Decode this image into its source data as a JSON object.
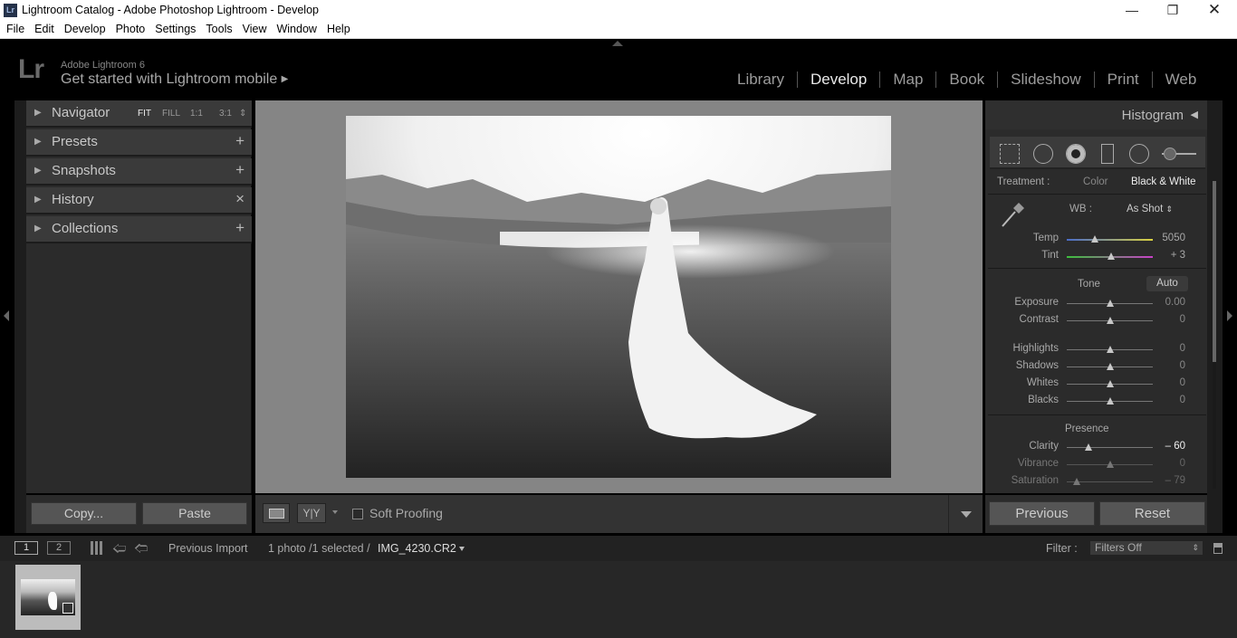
{
  "window": {
    "title": "Lightroom Catalog - Adobe Photoshop Lightroom - Develop",
    "app_icon": "Lr"
  },
  "menu": [
    "File",
    "Edit",
    "Develop",
    "Photo",
    "Settings",
    "Tools",
    "View",
    "Window",
    "Help"
  ],
  "identity": {
    "logo": "Lr",
    "brand": "Adobe Lightroom 6",
    "mobile": "Get started with Lightroom mobile",
    "mobile_arrow": "▶"
  },
  "modules": [
    "Library",
    "Develop",
    "Map",
    "Book",
    "Slideshow",
    "Print",
    "Web"
  ],
  "active_module": "Develop",
  "left_panel": {
    "navigator": {
      "label": "Navigator",
      "zoom": [
        "FIT",
        "FILL",
        "1:1",
        "3:1"
      ]
    },
    "presets": {
      "label": "Presets",
      "action": "+"
    },
    "snapshots": {
      "label": "Snapshots",
      "action": "+"
    },
    "history": {
      "label": "History",
      "action": "×"
    },
    "collections": {
      "label": "Collections",
      "action": "+"
    },
    "copy_button": "Copy...",
    "paste_button": "Paste"
  },
  "toolbar": {
    "soft_proofing": "Soft Proofing",
    "compare": "Y|Y"
  },
  "right_panel": {
    "histogram_label": "Histogram",
    "treatment_label": "Treatment :",
    "treatment_color": "Color",
    "treatment_bw": "Black & White",
    "wb_label": "WB :",
    "wb_value": "As Shot",
    "temp": {
      "label": "Temp",
      "value": "5050",
      "pos": 0.33
    },
    "tint": {
      "label": "Tint",
      "value": "+ 3",
      "pos": 0.52
    },
    "tone_label": "Tone",
    "auto_label": "Auto",
    "exposure": {
      "label": "Exposure",
      "value": "0.00",
      "pos": 0.5
    },
    "contrast": {
      "label": "Contrast",
      "value": "0",
      "pos": 0.5
    },
    "highlights": {
      "label": "Highlights",
      "value": "0",
      "pos": 0.5
    },
    "shadows": {
      "label": "Shadows",
      "value": "0",
      "pos": 0.5
    },
    "whites": {
      "label": "Whites",
      "value": "0",
      "pos": 0.5
    },
    "blacks": {
      "label": "Blacks",
      "value": "0",
      "pos": 0.5
    },
    "presence_label": "Presence",
    "clarity": {
      "label": "Clarity",
      "value": "– 60",
      "pos": 0.25
    },
    "vibrance": {
      "label": "Vibrance",
      "value": "0",
      "pos": 0.5
    },
    "saturation": {
      "label": "Saturation",
      "value": "– 79",
      "pos": 0.12
    },
    "previous_button": "Previous",
    "reset_button": "Reset"
  },
  "filmstrip": {
    "monitor1": "1",
    "monitor2": "2",
    "source": "Previous Import",
    "count": "1 photo /1 selected /",
    "filename": "IMG_4230.CR2",
    "filter_label": "Filter :",
    "filter_value": "Filters Off"
  }
}
